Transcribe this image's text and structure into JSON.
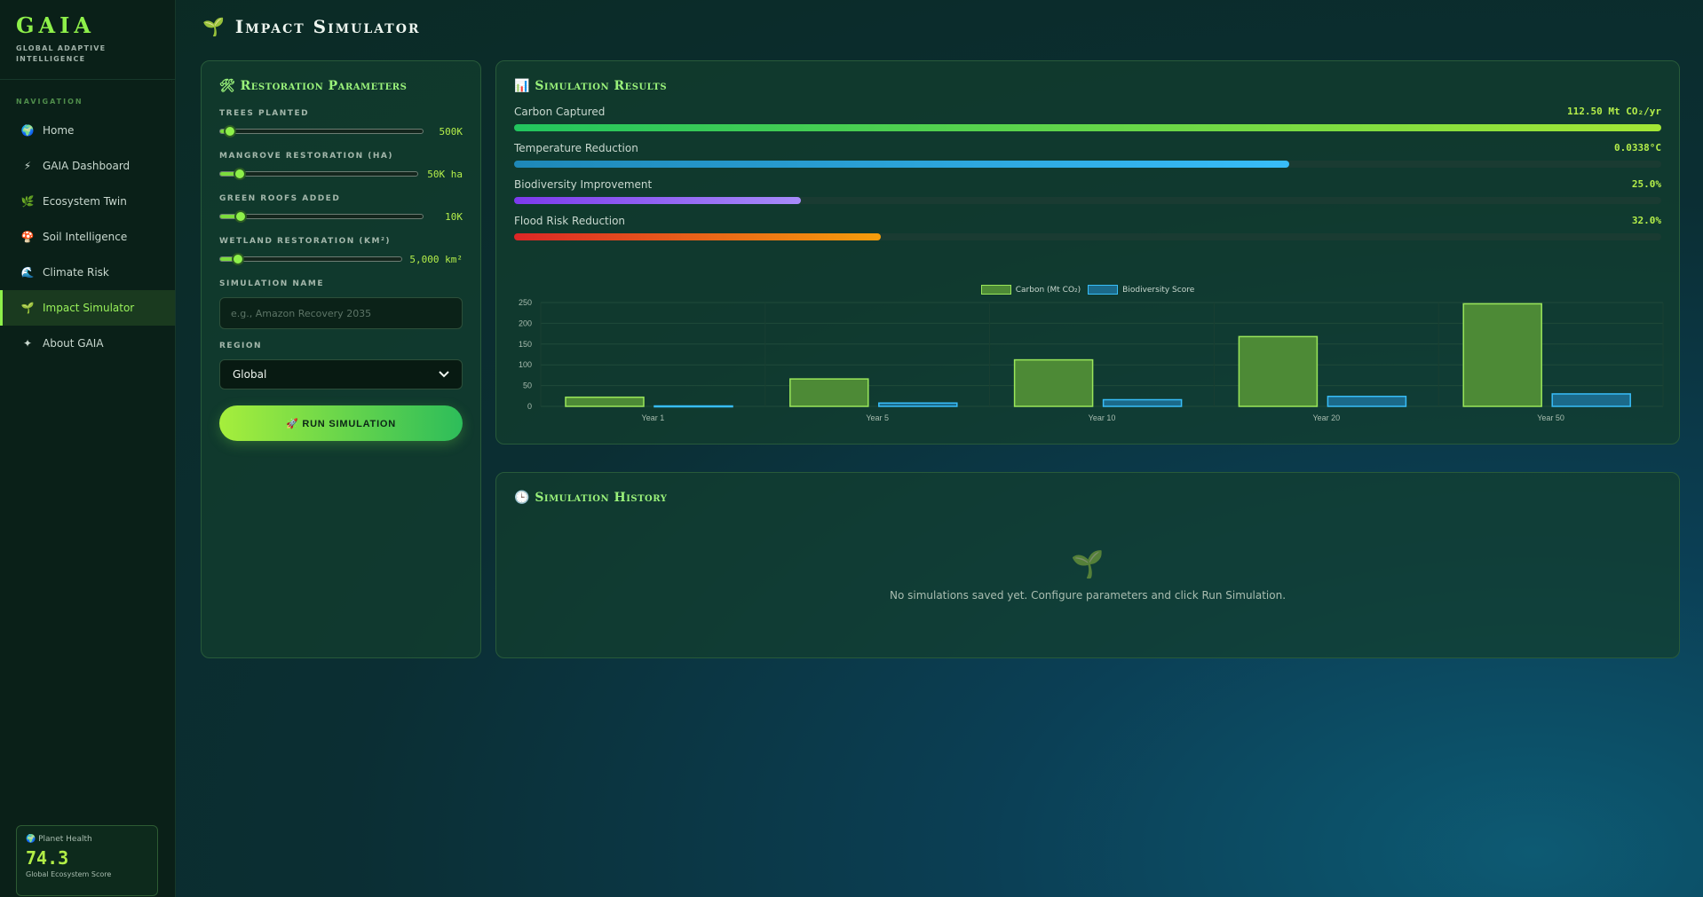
{
  "brand": {
    "title": "GAIA",
    "subtitle": "GLOBAL ADAPTIVE INTELLIGENCE"
  },
  "nav": {
    "label": "NAVIGATION",
    "items": [
      {
        "label": "Home",
        "icon": "globe-icon",
        "glyph": "🌍"
      },
      {
        "label": "GAIA Dashboard",
        "icon": "lightning-icon",
        "glyph": "⚡"
      },
      {
        "label": "Ecosystem Twin",
        "icon": "leaf-icon",
        "glyph": "🌿"
      },
      {
        "label": "Soil Intelligence",
        "icon": "mushroom-icon",
        "glyph": "🍄"
      },
      {
        "label": "Climate Risk",
        "icon": "wave-icon",
        "glyph": "🌊"
      },
      {
        "label": "Impact Simulator",
        "icon": "seedling-icon",
        "glyph": "🌱",
        "active": true
      },
      {
        "label": "About GAIA",
        "icon": "sparkle-icon",
        "glyph": "✦"
      }
    ]
  },
  "planet_health": {
    "label": "Planet Health",
    "value": "74.3",
    "sub": "Global Ecosystem Score"
  },
  "page": {
    "title": "Impact Simulator"
  },
  "params": {
    "title": "Restoration Parameters",
    "sliders": [
      {
        "label": "Trees Planted",
        "value": "500K",
        "fraction": 0.05
      },
      {
        "label": "Mangrove Restoration (ha)",
        "value": "50K ha",
        "fraction": 0.1
      },
      {
        "label": "Green Roofs Added",
        "value": "10K",
        "fraction": 0.1
      },
      {
        "label": "Wetland Restoration (km²)",
        "value": "5,000 km²",
        "fraction": 0.1
      }
    ],
    "name_label": "Simulation Name",
    "name_placeholder": "e.g., Amazon Recovery 2035",
    "region_label": "Region",
    "region_value": "Global",
    "run_label": "🚀 RUN SIMULATION"
  },
  "results": {
    "title": "Simulation Results",
    "metrics": [
      {
        "label": "Carbon Captured",
        "value": "112.50 Mt CO₂/yr",
        "fraction": 1.0,
        "color_from": "#22c55e",
        "color_to": "#a3e635"
      },
      {
        "label": "Temperature Reduction",
        "value": "0.0338°C",
        "fraction": 0.676,
        "color_from": "#1e88b8",
        "color_to": "#38bdf8"
      },
      {
        "label": "Biodiversity Improvement",
        "value": "25.0%",
        "fraction": 0.25,
        "color_from": "#7c3aed",
        "color_to": "#a78bfa"
      },
      {
        "label": "Flood Risk Reduction",
        "value": "32.0%",
        "fraction": 0.32,
        "color_from": "#dc2626",
        "color_to": "#f59e0b"
      }
    ]
  },
  "chart_data": {
    "type": "bar",
    "categories": [
      "Year 1",
      "Year 5",
      "Year 10",
      "Year 20",
      "Year 50"
    ],
    "series": [
      {
        "name": "Carbon (Mt CO₂)",
        "values": [
          22,
          66,
          112,
          168,
          247
        ],
        "color": "#4d8a36",
        "stroke": "#9ae65a"
      },
      {
        "name": "Biodiversity Score",
        "values": [
          1,
          8,
          16,
          24,
          30
        ],
        "color": "#1b6a8a",
        "stroke": "#38bdf8"
      }
    ],
    "yticks": [
      "0",
      "50",
      "100",
      "150",
      "200",
      "250"
    ],
    "ylim": [
      0,
      250
    ],
    "legend": "top-center",
    "grid": true
  },
  "history": {
    "title": "Simulation History",
    "empty_text": "No simulations saved yet. Configure parameters and click Run Simulation."
  }
}
